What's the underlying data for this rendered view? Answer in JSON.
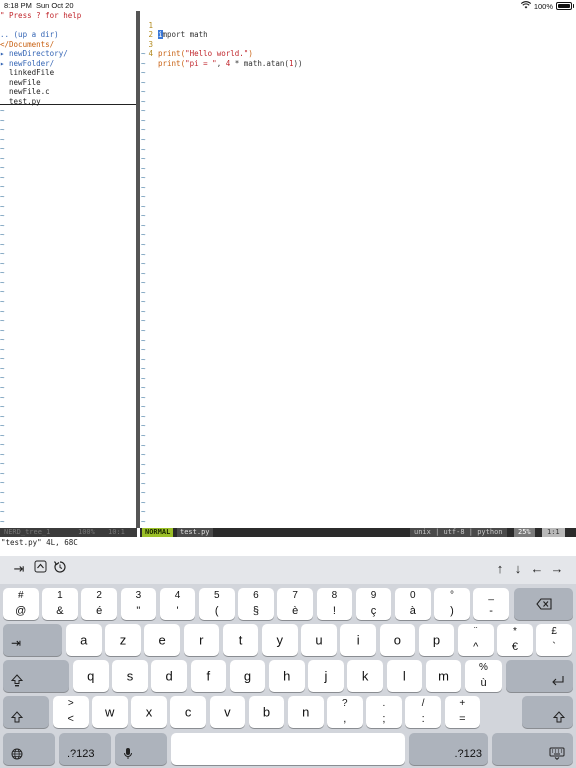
{
  "statusbar": {
    "time": "8:18 PM",
    "date": "Sun Oct 20",
    "battery": "100%"
  },
  "tree": {
    "help": "\" Press ? for help",
    "up": ".. (up a dir)",
    "cwd": "</Documents/",
    "items": [
      {
        "text": "▸ newDirectory/",
        "kind": "dir"
      },
      {
        "text": "▸ newFolder/",
        "kind": "dir"
      },
      {
        "text": "  linkedFile",
        "kind": "file"
      },
      {
        "text": "  newFile",
        "kind": "file"
      },
      {
        "text": "  newFile.c",
        "kind": "file"
      },
      {
        "text": "  test.py",
        "kind": "file"
      }
    ],
    "tilde": "~"
  },
  "editor": {
    "lines": [
      {
        "num": "1",
        "cursor": "i",
        "rest": "mport math"
      },
      {
        "num": "2"
      },
      {
        "num": "3",
        "fn": "print(",
        "str": "\"Hello world.\"",
        "end": ")"
      },
      {
        "num": "4",
        "fn": "print(",
        "str": "\"pi = \"",
        "mid": ", ",
        "n": "4",
        "tail": " * math.atan(",
        "n2": "1",
        "end": "))"
      }
    ]
  },
  "nerdtree_status": {
    "name": "NERD_tree_1",
    "pct": "100%",
    "pos": "10:1"
  },
  "status": {
    "mode": "NORMAL",
    "file": "test.py",
    "enc": "unix | utf-8 | python",
    "pct": "25%",
    "pos": "1:1"
  },
  "message": "\"test.py\" 4L, 68C",
  "keyboard": {
    "toolbar": {
      "tab": "⇥",
      "ctrl": "⌃",
      "esc": "↺",
      "up": "↑",
      "down": "↓",
      "left": "←",
      "right": "→"
    },
    "row1": [
      {
        "top": "#",
        "bot": "@"
      },
      {
        "top": "1",
        "bot": "&"
      },
      {
        "top": "2",
        "bot": "é"
      },
      {
        "top": "3",
        "bot": "\""
      },
      {
        "top": "4",
        "bot": "'"
      },
      {
        "top": "5",
        "bot": "("
      },
      {
        "top": "6",
        "bot": "§"
      },
      {
        "top": "7",
        "bot": "è"
      },
      {
        "top": "8",
        "bot": "!"
      },
      {
        "top": "9",
        "bot": "ç"
      },
      {
        "top": "0",
        "bot": "à"
      },
      {
        "top": "°",
        "bot": ")"
      },
      {
        "top": "_",
        "bot": "-"
      }
    ],
    "row2": [
      "a",
      "z",
      "e",
      "r",
      "t",
      "y",
      "u",
      "i",
      "o",
      "p"
    ],
    "row2b": [
      {
        "top": "¨",
        "bot": "^"
      },
      {
        "top": "*",
        "bot": "€"
      },
      {
        "top": "£",
        "bot": "`"
      }
    ],
    "row3": [
      "q",
      "s",
      "d",
      "f",
      "g",
      "h",
      "j",
      "k",
      "l",
      "m"
    ],
    "row3b": {
      "top": "%",
      "bot": "ù"
    },
    "row4a": {
      "top": ">",
      "bot": "<"
    },
    "row4": [
      "w",
      "x",
      "c",
      "v",
      "b",
      "n"
    ],
    "row4b": [
      {
        "top": "?",
        "bot": ","
      },
      {
        "top": ".",
        "bot": ";"
      },
      {
        "top": "/",
        "bot": ":"
      },
      {
        "top": "+",
        "bot": "="
      }
    ],
    "numkey": ".?123"
  }
}
